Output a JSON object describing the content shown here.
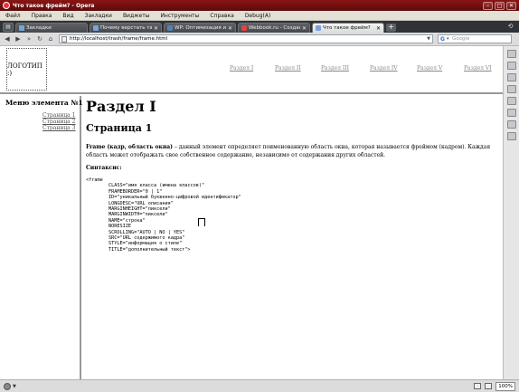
{
  "window": {
    "title": "Что такое фрейм? - Opera",
    "buttons": [
      "–",
      "□",
      "✕"
    ]
  },
  "menu": [
    "Файл",
    "Правка",
    "Вид",
    "Закладки",
    "Виджеты",
    "Инструменты",
    "Справка",
    "Debug(A)"
  ],
  "tabs": [
    {
      "label": "Закладки",
      "active": false
    },
    {
      "label": "Почему верстать табл...",
      "active": false
    },
    {
      "label": "WP: Оптимизация и ре...",
      "active": false
    },
    {
      "label": "Webbook.ru - Создание ...",
      "active": false
    },
    {
      "label": "Что такое фрейм?",
      "active": true
    }
  ],
  "address": {
    "url": "http://localhost/trash/frame/frame.html",
    "search_engine": "G",
    "search_placeholder": "Google"
  },
  "page": {
    "logo": "ЛОГОТИП :)",
    "top_nav": [
      "Раздел I",
      "Раздел II",
      "Раздел III",
      "Раздел IV",
      "Раздел V",
      "Раздел VI"
    ],
    "sidebar": {
      "title": "Меню элемента №1",
      "links": [
        "Страница 1",
        "Страница 2",
        "Страница 3"
      ]
    },
    "main": {
      "heading": "Раздел I",
      "subheading": "Страница 1",
      "term": "Frame (кадр, область окна)",
      "description": " – данный элемент определяет поименованную область окна, которая называется фреймом (кадром). Каждая область может отображать свое собственное содержание, независимо от содержания других областей.",
      "syntax_label": "Синтаксис:",
      "code": "<frame\n        CLASS=\"имя класса (имена классов)\"\n        FRAMEBORDER=\"0 | 1\"\n        ID=\"уникальный буквенно-цифровой идентификатор\"\n        LONGDESC=\"URL описания\"\n        MARGINHEIGHT=\"пиксели\"\n        MARGINWIDTH=\"пиксели\"\n        NAME=\"строка\"\n        NORESIZE\n        SCROLLING=\"AUTO | NO | YES\"\n        SRC=\"URL содержимого кадра\"\n        STYLE=\"информация о стиле\"\n        TITLE=\"дополнительный текст\">"
    }
  },
  "status": {
    "zoom": "100%"
  }
}
